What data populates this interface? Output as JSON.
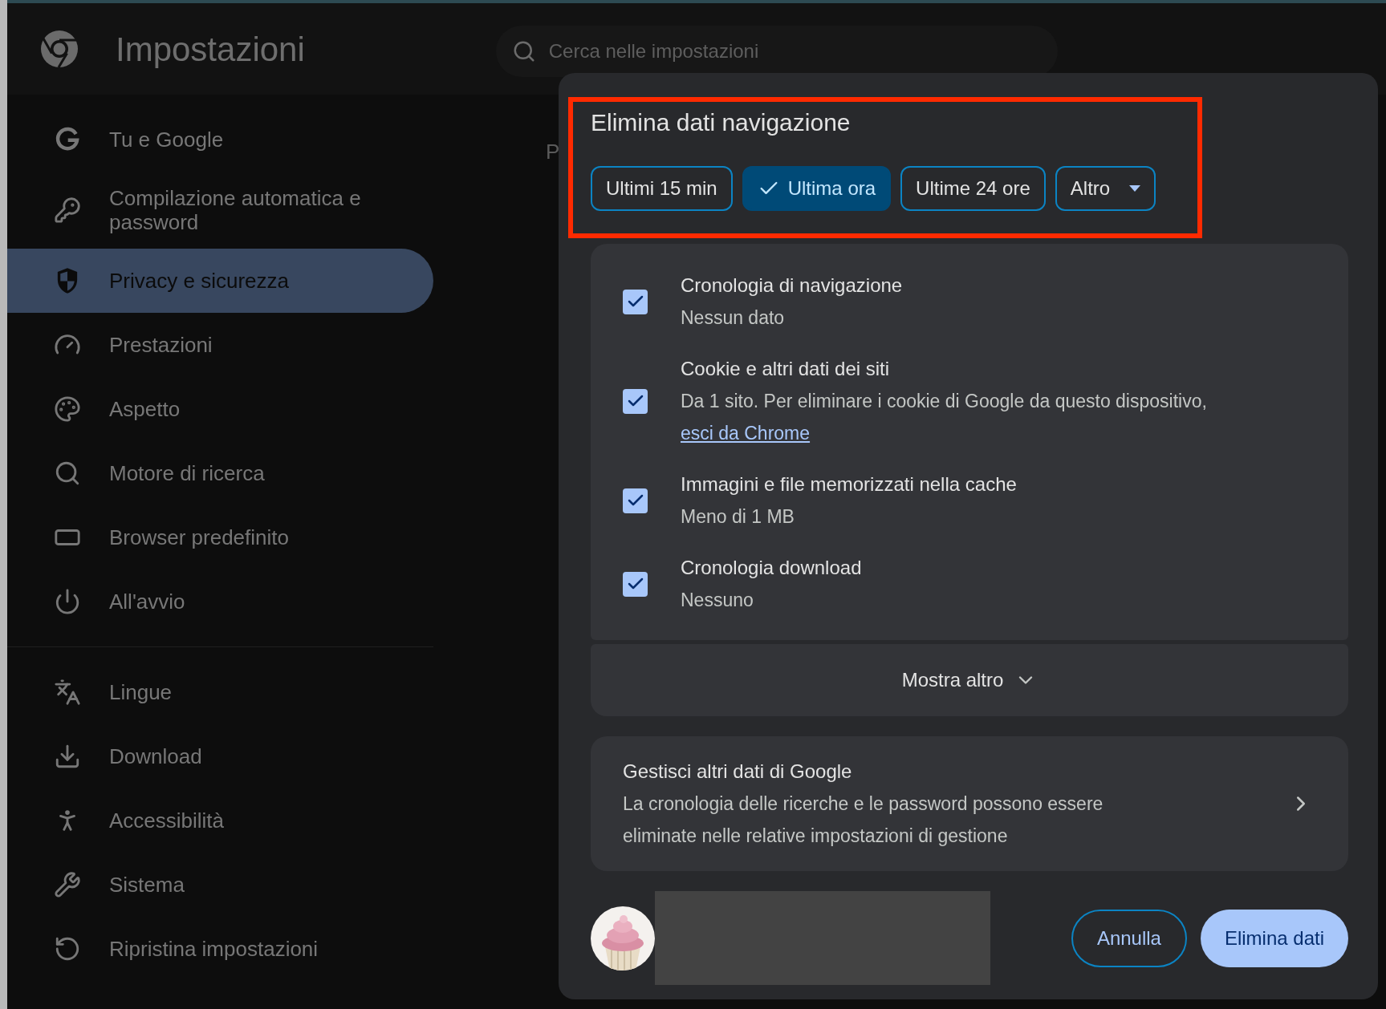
{
  "header": {
    "title": "Impostazioni",
    "search": {
      "placeholder": "Cerca nelle impostazioni"
    }
  },
  "sidebar": {
    "groups": [
      [
        {
          "label": "Tu e Google",
          "selected": false
        },
        {
          "label": "Compilazione automatica e password",
          "selected": false
        },
        {
          "label": "Privacy e sicurezza",
          "selected": true
        },
        {
          "label": "Prestazioni",
          "selected": false
        },
        {
          "label": "Aspetto",
          "selected": false
        },
        {
          "label": "Motore di ricerca",
          "selected": false
        },
        {
          "label": "Browser predefinito",
          "selected": false
        },
        {
          "label": "All'avvio",
          "selected": false
        }
      ],
      [
        {
          "label": "Lingue",
          "selected": false
        },
        {
          "label": "Download",
          "selected": false
        },
        {
          "label": "Accessibilità",
          "selected": false
        },
        {
          "label": "Sistema",
          "selected": false
        },
        {
          "label": "Ripristina impostazioni",
          "selected": false
        }
      ]
    ]
  },
  "page": {
    "heading_fragment": "P"
  },
  "dialog": {
    "title": "Elimina dati navigazione",
    "time_ranges": [
      {
        "label": "Ultimi 15 min",
        "selected": false,
        "kind": "option"
      },
      {
        "label": "Ultima ora",
        "selected": true,
        "kind": "option"
      },
      {
        "label": "Ultime 24 ore",
        "selected": false,
        "kind": "option"
      },
      {
        "label": "Altro",
        "selected": false,
        "kind": "dropdown"
      }
    ],
    "items": [
      {
        "title": "Cronologia di navigazione",
        "description": "Nessun dato",
        "checked": true
      },
      {
        "title": "Cookie e altri dati dei siti",
        "description": "Da 1 sito. Per eliminare i cookie di Google da questo dispositivo,",
        "link": "esci da Chrome",
        "checked": true
      },
      {
        "title": "Immagini e file memorizzati nella cache",
        "description": "Meno di 1 MB",
        "checked": true
      },
      {
        "title": "Cronologia download",
        "description": "Nessuno",
        "checked": true
      }
    ],
    "show_more": "Mostra altro",
    "manage": {
      "title": "Gestisci altri dati di Google",
      "description": "La cronologia delle ricerche e le password possono essere eliminate nelle relative impostazioni di gestione"
    },
    "buttons": [
      {
        "label": "Annulla",
        "kind": "secondary"
      },
      {
        "label": "Elimina dati",
        "kind": "primary"
      }
    ]
  }
}
